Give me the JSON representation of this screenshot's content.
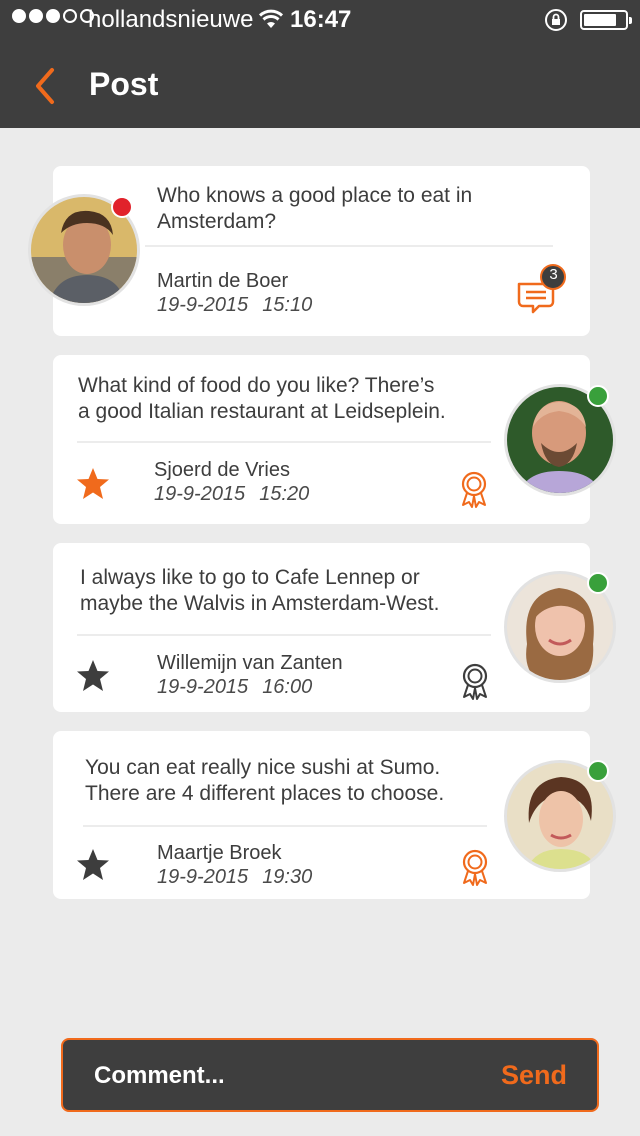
{
  "status_bar": {
    "carrier": "hollandsnieuwe",
    "time": "16:47",
    "signal_bars_filled": 3,
    "signal_bars_total": 5,
    "battery_level": 0.8
  },
  "nav": {
    "back_icon": "chevron-left-icon",
    "title": "Post"
  },
  "colors": {
    "accent": "#f06a1c",
    "header_bg": "#3e3e3e",
    "background": "#ebebeb",
    "offline": "#e1222b",
    "online": "#39a03b"
  },
  "post": {
    "message": "Who knows a good place to eat in Amsterdam?",
    "author": "Martin de Boer",
    "date": "19-9-2015",
    "time": "15:10",
    "comment_count": "3",
    "presence": "offline"
  },
  "replies": [
    {
      "message_line1": "What kind of food do you like? There’s",
      "message_line2": "a good Italian restaurant at Leidseplein.",
      "author": "Sjoerd de Vries",
      "date": "19-9-2015",
      "time": "15:20",
      "starred": true,
      "awarded": true,
      "presence": "online"
    },
    {
      "message_line1": "I always like to go to Cafe Lennep or",
      "message_line2": "maybe the Walvis in Amsterdam-West.",
      "author": "Willemijn van Zanten",
      "date": "19-9-2015",
      "time": "16:00",
      "starred": false,
      "awarded": false,
      "presence": "online"
    },
    {
      "message_line1": "You can eat really nice sushi at Sumo.",
      "message_line2": "There are 4 different places to choose.",
      "author": "Maartje Broek",
      "date": "19-9-2015",
      "time": "19:30",
      "starred": false,
      "awarded": true,
      "presence": "online"
    }
  ],
  "comment_bar": {
    "placeholder": "Comment...",
    "send_label": "Send"
  }
}
